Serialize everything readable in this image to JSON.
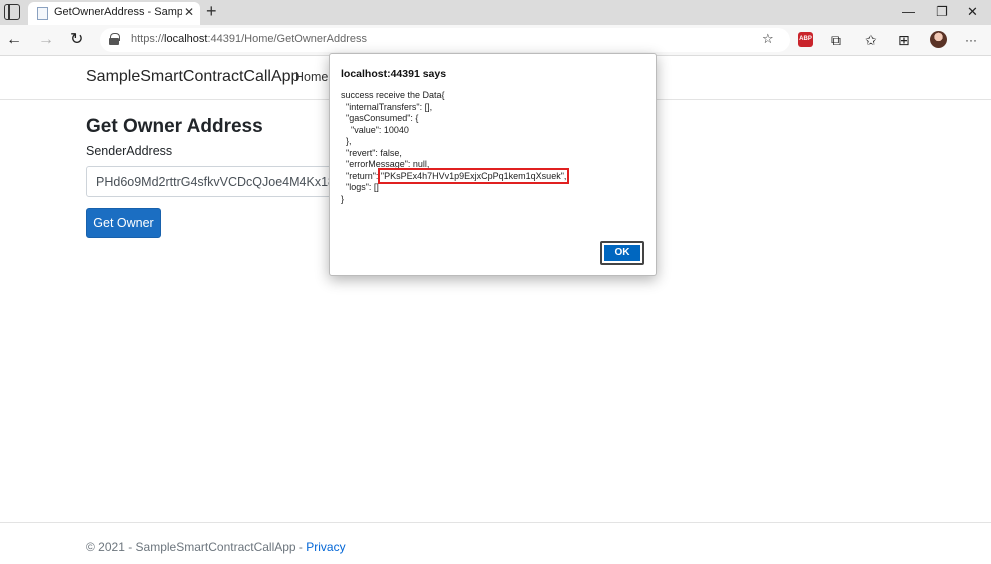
{
  "browser": {
    "tab_title": "GetOwnerAddress - SampleSmartContractCallApp",
    "tab_close": "✕",
    "new_tab": "+",
    "url_prefix": "https://",
    "url_host": "localhost",
    "url_path": ":44391/Home/GetOwnerAddress",
    "abp_label": "ABP",
    "more_label": "···",
    "window_controls": {
      "minimize": "—",
      "maximize": "❐",
      "close": "✕"
    }
  },
  "navbar": {
    "brand": "SampleSmartContractCallApp",
    "home": "Home"
  },
  "main": {
    "title": "Get Owner Address",
    "sender_label": "SenderAddress",
    "sender_value": "PHd6o9Md2rttrG4sfkvVCDcQJoe4M4Kx18",
    "button_label": "Get Owner"
  },
  "footer": {
    "copyright": "© 2021 - SampleSmartContractCallApp - ",
    "privacy_link": "Privacy"
  },
  "dialog": {
    "title": "localhost:44391 says",
    "lines": [
      "success receive the Data{",
      "  \"internalTransfers\": [],",
      "  \"gasConsumed\": {",
      "    \"value\": 10040",
      "  },",
      "  \"revert\": false,",
      "  \"errorMessage\": null,",
      "  \"return\": ",
      "  \"logs\": []",
      "}"
    ],
    "return_value": "\"PKsPEx4h7HVv1p9ExjxCpPq1kem1qXsuek\",",
    "ok_label": "OK"
  },
  "colors": {
    "primary_button": "#1b6ec2",
    "dialog_ok": "#0067c0",
    "highlight_box": "#e02020",
    "abp_badge": "#c9242b",
    "link": "#0366d6"
  },
  "icons": [
    "tab-actions-icon",
    "favicon-icon",
    "back-icon",
    "forward-icon",
    "refresh-icon",
    "lock-icon",
    "favorites-add-icon",
    "adblock-plus-icon",
    "extensions-icon",
    "favorites-icon",
    "collections-icon",
    "profile-avatar-icon",
    "more-icon"
  ]
}
